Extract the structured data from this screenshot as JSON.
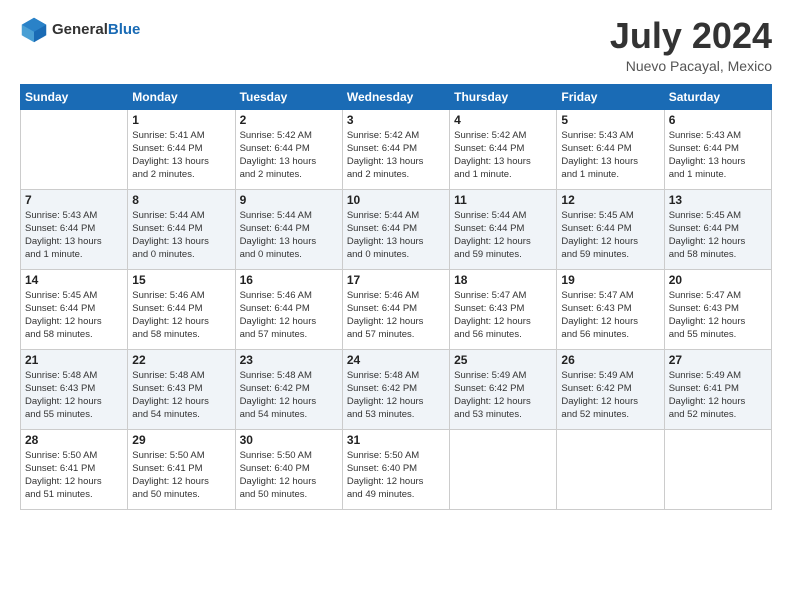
{
  "header": {
    "logo_general": "General",
    "logo_blue": "Blue",
    "month_year": "July 2024",
    "location": "Nuevo Pacayal, Mexico"
  },
  "days_of_week": [
    "Sunday",
    "Monday",
    "Tuesday",
    "Wednesday",
    "Thursday",
    "Friday",
    "Saturday"
  ],
  "weeks": [
    [
      {
        "day": "",
        "info": ""
      },
      {
        "day": "1",
        "info": "Sunrise: 5:41 AM\nSunset: 6:44 PM\nDaylight: 13 hours\nand 2 minutes."
      },
      {
        "day": "2",
        "info": "Sunrise: 5:42 AM\nSunset: 6:44 PM\nDaylight: 13 hours\nand 2 minutes."
      },
      {
        "day": "3",
        "info": "Sunrise: 5:42 AM\nSunset: 6:44 PM\nDaylight: 13 hours\nand 2 minutes."
      },
      {
        "day": "4",
        "info": "Sunrise: 5:42 AM\nSunset: 6:44 PM\nDaylight: 13 hours\nand 1 minute."
      },
      {
        "day": "5",
        "info": "Sunrise: 5:43 AM\nSunset: 6:44 PM\nDaylight: 13 hours\nand 1 minute."
      },
      {
        "day": "6",
        "info": "Sunrise: 5:43 AM\nSunset: 6:44 PM\nDaylight: 13 hours\nand 1 minute."
      }
    ],
    [
      {
        "day": "7",
        "info": "Sunrise: 5:43 AM\nSunset: 6:44 PM\nDaylight: 13 hours\nand 1 minute."
      },
      {
        "day": "8",
        "info": "Sunrise: 5:44 AM\nSunset: 6:44 PM\nDaylight: 13 hours\nand 0 minutes."
      },
      {
        "day": "9",
        "info": "Sunrise: 5:44 AM\nSunset: 6:44 PM\nDaylight: 13 hours\nand 0 minutes."
      },
      {
        "day": "10",
        "info": "Sunrise: 5:44 AM\nSunset: 6:44 PM\nDaylight: 13 hours\nand 0 minutes."
      },
      {
        "day": "11",
        "info": "Sunrise: 5:44 AM\nSunset: 6:44 PM\nDaylight: 12 hours\nand 59 minutes."
      },
      {
        "day": "12",
        "info": "Sunrise: 5:45 AM\nSunset: 6:44 PM\nDaylight: 12 hours\nand 59 minutes."
      },
      {
        "day": "13",
        "info": "Sunrise: 5:45 AM\nSunset: 6:44 PM\nDaylight: 12 hours\nand 58 minutes."
      }
    ],
    [
      {
        "day": "14",
        "info": "Sunrise: 5:45 AM\nSunset: 6:44 PM\nDaylight: 12 hours\nand 58 minutes."
      },
      {
        "day": "15",
        "info": "Sunrise: 5:46 AM\nSunset: 6:44 PM\nDaylight: 12 hours\nand 58 minutes."
      },
      {
        "day": "16",
        "info": "Sunrise: 5:46 AM\nSunset: 6:44 PM\nDaylight: 12 hours\nand 57 minutes."
      },
      {
        "day": "17",
        "info": "Sunrise: 5:46 AM\nSunset: 6:44 PM\nDaylight: 12 hours\nand 57 minutes."
      },
      {
        "day": "18",
        "info": "Sunrise: 5:47 AM\nSunset: 6:43 PM\nDaylight: 12 hours\nand 56 minutes."
      },
      {
        "day": "19",
        "info": "Sunrise: 5:47 AM\nSunset: 6:43 PM\nDaylight: 12 hours\nand 56 minutes."
      },
      {
        "day": "20",
        "info": "Sunrise: 5:47 AM\nSunset: 6:43 PM\nDaylight: 12 hours\nand 55 minutes."
      }
    ],
    [
      {
        "day": "21",
        "info": "Sunrise: 5:48 AM\nSunset: 6:43 PM\nDaylight: 12 hours\nand 55 minutes."
      },
      {
        "day": "22",
        "info": "Sunrise: 5:48 AM\nSunset: 6:43 PM\nDaylight: 12 hours\nand 54 minutes."
      },
      {
        "day": "23",
        "info": "Sunrise: 5:48 AM\nSunset: 6:42 PM\nDaylight: 12 hours\nand 54 minutes."
      },
      {
        "day": "24",
        "info": "Sunrise: 5:48 AM\nSunset: 6:42 PM\nDaylight: 12 hours\nand 53 minutes."
      },
      {
        "day": "25",
        "info": "Sunrise: 5:49 AM\nSunset: 6:42 PM\nDaylight: 12 hours\nand 53 minutes."
      },
      {
        "day": "26",
        "info": "Sunrise: 5:49 AM\nSunset: 6:42 PM\nDaylight: 12 hours\nand 52 minutes."
      },
      {
        "day": "27",
        "info": "Sunrise: 5:49 AM\nSunset: 6:41 PM\nDaylight: 12 hours\nand 52 minutes."
      }
    ],
    [
      {
        "day": "28",
        "info": "Sunrise: 5:50 AM\nSunset: 6:41 PM\nDaylight: 12 hours\nand 51 minutes."
      },
      {
        "day": "29",
        "info": "Sunrise: 5:50 AM\nSunset: 6:41 PM\nDaylight: 12 hours\nand 50 minutes."
      },
      {
        "day": "30",
        "info": "Sunrise: 5:50 AM\nSunset: 6:40 PM\nDaylight: 12 hours\nand 50 minutes."
      },
      {
        "day": "31",
        "info": "Sunrise: 5:50 AM\nSunset: 6:40 PM\nDaylight: 12 hours\nand 49 minutes."
      },
      {
        "day": "",
        "info": ""
      },
      {
        "day": "",
        "info": ""
      },
      {
        "day": "",
        "info": ""
      }
    ]
  ]
}
